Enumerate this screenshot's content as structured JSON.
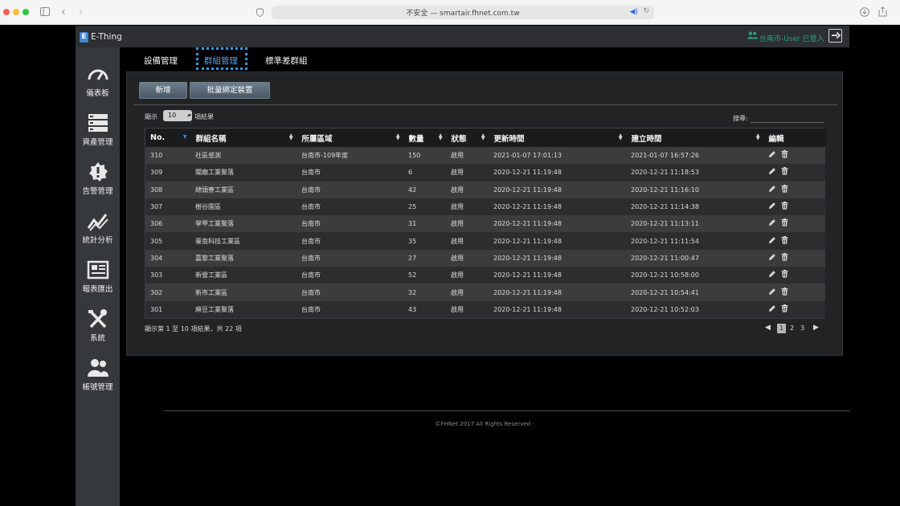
{
  "browser": {
    "address": "不安全 — smartair.fhnet.com.tw"
  },
  "app": {
    "logo_letter": "E",
    "logo_text": "E-Thing",
    "user_text": "台南市-User 已登入"
  },
  "sidebar": {
    "items": [
      {
        "label": "儀表板",
        "icon": "gauge-icon"
      },
      {
        "label": "資產管理",
        "icon": "server-icon"
      },
      {
        "label": "告警管理",
        "icon": "alert-gear-icon"
      },
      {
        "label": "統計分析",
        "icon": "trend-chart-icon"
      },
      {
        "label": "報表匯出",
        "icon": "report-icon"
      },
      {
        "label": "系統",
        "icon": "tools-icon"
      },
      {
        "label": "帳號管理",
        "icon": "users-icon"
      }
    ]
  },
  "tabs": [
    {
      "label": "設備管理",
      "active": false
    },
    {
      "label": "群組管理",
      "active": true
    },
    {
      "label": "標準差群組",
      "active": false
    }
  ],
  "toolbar": {
    "add_label": "新增",
    "bind_label": "批量綁定裝置"
  },
  "table_controls": {
    "show_prefix": "顯示",
    "page_length": "10",
    "show_suffix": "項結果",
    "search_label": "搜尋:",
    "search_value": ""
  },
  "table": {
    "columns": [
      "No.",
      "群組名稱",
      "所屬區域",
      "數量",
      "狀態",
      "更新時間",
      "建立時間",
      "編輯"
    ],
    "rows": [
      [
        "310",
        "社區感測",
        "台南市-109年度",
        "150",
        "啟用",
        "2021-01-07 17:01:13",
        "2021-01-07 16:57:26"
      ],
      [
        "309",
        "關廟工業聚落",
        "台南市",
        "6",
        "啟用",
        "2020-12-21 11:19:48",
        "2020-12-21 11:18:53"
      ],
      [
        "308",
        "總頭寮工業區",
        "台南市",
        "42",
        "啟用",
        "2020-12-21 11:19:48",
        "2020-12-21 11:16:10"
      ],
      [
        "307",
        "樹谷園區",
        "台南市",
        "25",
        "啟用",
        "2020-12-21 11:19:48",
        "2020-12-21 11:14:38"
      ],
      [
        "306",
        "學甲工業聚落",
        "台南市",
        "31",
        "啟用",
        "2020-12-21 11:19:48",
        "2020-12-21 11:13:11"
      ],
      [
        "305",
        "臺南科技工業區",
        "台南市",
        "35",
        "啟用",
        "2020-12-21 11:19:48",
        "2020-12-21 11:11:54"
      ],
      [
        "304",
        "嘉黎工業聚落",
        "台南市",
        "27",
        "啟用",
        "2020-12-21 11:19:48",
        "2020-12-21 11:00:47"
      ],
      [
        "303",
        "新營工業區",
        "台南市",
        "52",
        "啟用",
        "2020-12-21 11:19:48",
        "2020-12-21 10:58:00"
      ],
      [
        "302",
        "新市工業區",
        "台南市",
        "32",
        "啟用",
        "2020-12-21 11:19:48",
        "2020-12-21 10:54:41"
      ],
      [
        "301",
        "麻豆工業聚落",
        "台南市",
        "43",
        "啟用",
        "2020-12-21 11:19:48",
        "2020-12-21 10:52:03"
      ]
    ]
  },
  "pagination": {
    "info": "顯示第 1 至 10 項結果，共 22 項",
    "pages": [
      "1",
      "2",
      "3"
    ],
    "current": "1"
  },
  "footer": {
    "copyright": "©FHNet 2017 All Rights Reserved ·"
  },
  "colors": {
    "accent": "#3b97dc",
    "user_green": "#2c9f78",
    "sidebar_bg": "#35393b"
  }
}
